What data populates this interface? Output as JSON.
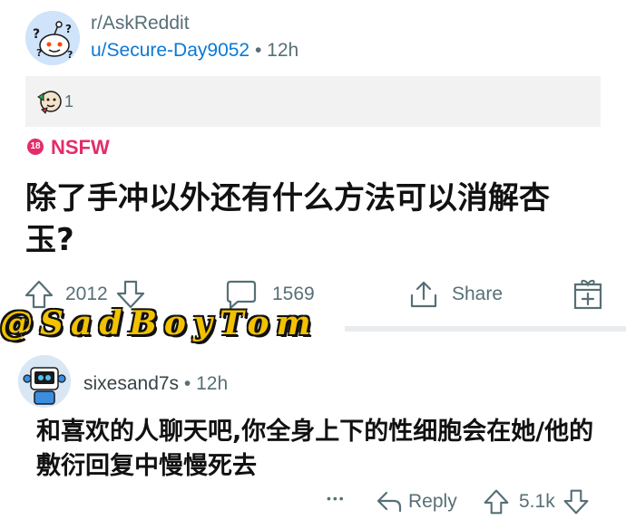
{
  "post": {
    "subreddit": "r/AskReddit",
    "author": "u/Secure-Day9052",
    "separator": "•",
    "time": "12h",
    "award_count": "1",
    "nsfw_badge": "18",
    "nsfw_label": "NSFW",
    "title": "除了手冲以外还有什么方法可以消解杏玉?",
    "actions": {
      "upvotes": "2012",
      "comments": "1569",
      "share": "Share"
    }
  },
  "watermark": "@SadBoyTom",
  "comment": {
    "author": "sixesand7s",
    "separator": "•",
    "time": "12h",
    "body": "和喜欢的人聊天吧,你全身上下的性细胞会在她/他的敷衍回复中慢慢死去",
    "more": "•••",
    "reply": "Reply",
    "votes": "5.1k"
  },
  "colors": {
    "link_blue": "#0a79d6",
    "nsfw_pink": "#e32c6c",
    "meta_gray": "#576f76"
  }
}
